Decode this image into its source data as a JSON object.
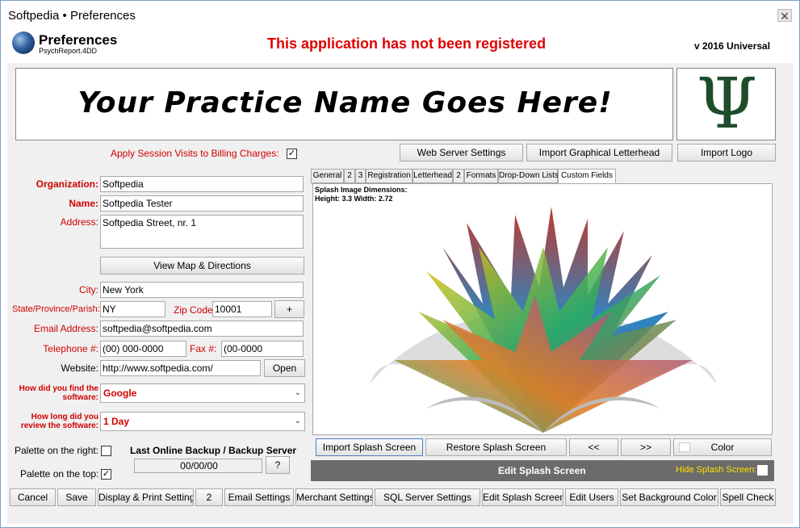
{
  "window": {
    "title": "Softpedia  • Preferences"
  },
  "header": {
    "title": "Preferences",
    "subtitle": "PsychReport.4DD",
    "registration_warning": "This application has not been registered",
    "version": "v 2016 Universal"
  },
  "banner": {
    "text": "Your Practice Name Goes Here!",
    "symbol": "Ψ"
  },
  "top_buttons": {
    "web_server": "Web Server Settings",
    "import_letterhead": "Import Graphical Letterhead",
    "import_logo": "Import Logo"
  },
  "billing": {
    "label": "Apply Session Visits to Billing Charges:",
    "checked": true
  },
  "form": {
    "organization_label": "Organization:",
    "organization": "Softpedia",
    "name_label": "Name:",
    "name": "Softpedia Tester",
    "address_label": "Address:",
    "address": "Softpedia Street, nr. 1",
    "view_map": "View Map & Directions",
    "city_label": "City:",
    "city": "New York",
    "state_label": "State/Province/Parish:",
    "state": "NY",
    "zip_label": "Zip Code:",
    "zip": "10001",
    "plus": "+",
    "email_label": "Email Address:",
    "email": "softpedia@softpedia.com",
    "telephone_label": "Telephone #:",
    "telephone": "(00) 000-0000",
    "fax_label": "Fax #:",
    "fax": "(00-0000",
    "website_label": "Website:",
    "website": "http://www.softpedia.com/",
    "open": "Open",
    "find_label_1": "How did you find the",
    "find_label_2": "software:",
    "find_value": "Google",
    "review_label_1": "How long did you",
    "review_label_2": "review the software:",
    "review_value": "1 Day"
  },
  "palette": {
    "right_label": "Palette on the right:",
    "right_checked": false,
    "top_label": "Palette on the top:",
    "top_checked": true
  },
  "backup": {
    "label": "Last Online Backup / Backup Server",
    "value": "00/00/00",
    "help": "?"
  },
  "tabs": [
    "General",
    "2",
    "3",
    "Registration",
    "Letterhead",
    "2",
    "Formats",
    "Drop-Down Lists",
    "Custom Fields"
  ],
  "splash": {
    "dims_title": "Splash Image Dimensions:",
    "dims": "Height:  3.3    Width:  2.72",
    "import": "Import Splash Screen",
    "restore": "Restore Splash Screen",
    "prev": "<<",
    "next": ">>",
    "color": "Color",
    "edit_title": "Edit Splash Screen",
    "hide_label": "Hide Splash Screen:"
  },
  "bottom_buttons": [
    "Cancel",
    "Save",
    "Display & Print Settings",
    "2",
    "Email Settings",
    "Merchant Settings",
    "SQL Server Settings",
    "Edit Splash Screen",
    "Edit Users",
    "Set Background Color",
    "Spell Check"
  ],
  "colors": {
    "accent_red": "#d10000",
    "warning_red": "#e00000",
    "edit_bar": "#6b6b6b",
    "hide_label": "#ffe000"
  }
}
